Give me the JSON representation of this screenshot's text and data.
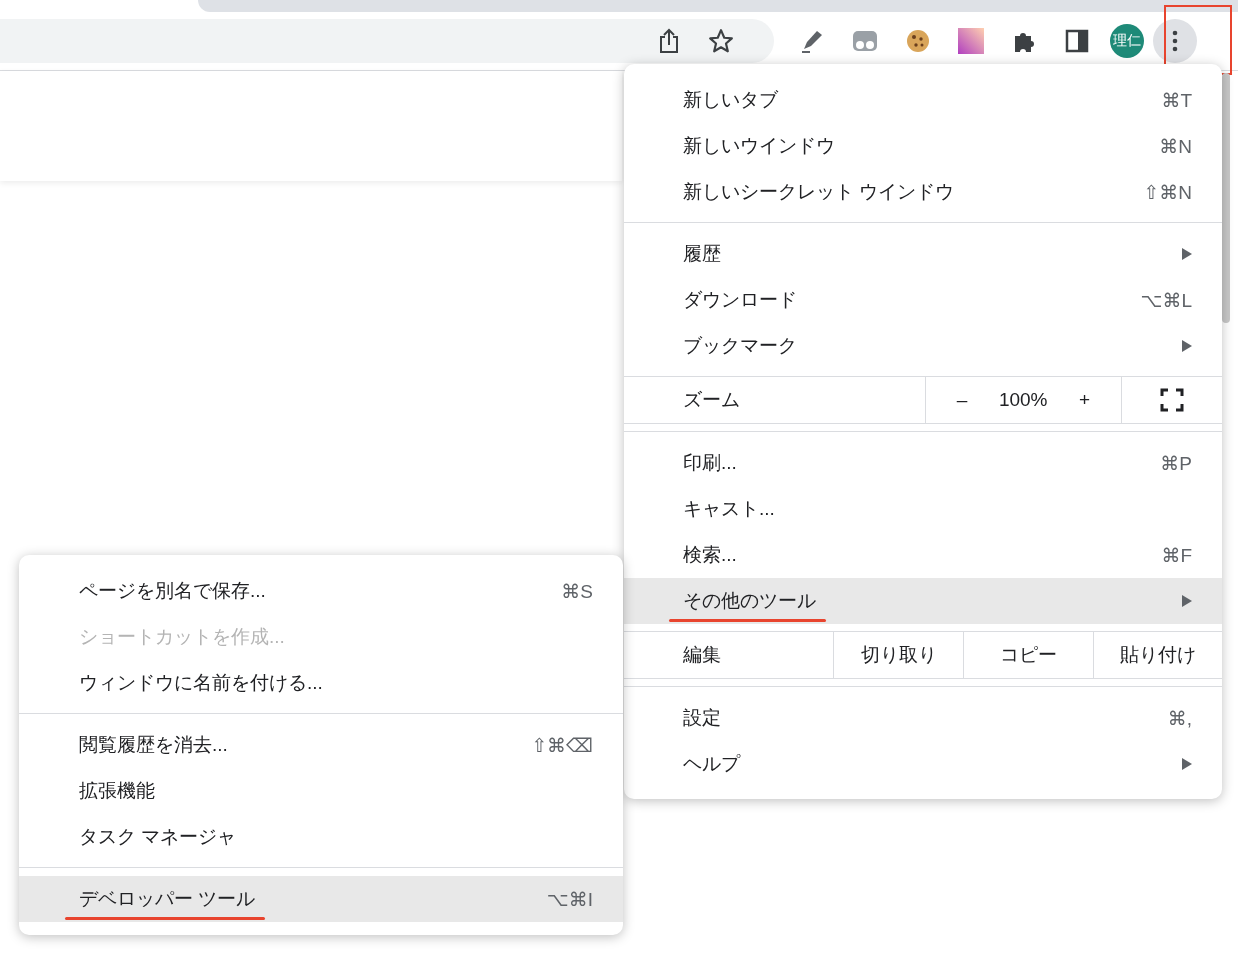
{
  "toolbar": {
    "avatar": {
      "label": "理仁"
    },
    "menu_button": {
      "highlighted": true
    }
  },
  "menu": {
    "sections": [
      [
        {
          "kind": "item",
          "label": "新しいタブ",
          "shortcut": "⌘T",
          "has_submenu": false,
          "selected": false,
          "disabled": false,
          "underlined": false
        },
        {
          "kind": "item",
          "label": "新しいウインドウ",
          "shortcut": "⌘N",
          "has_submenu": false,
          "selected": false,
          "disabled": false,
          "underlined": false
        },
        {
          "kind": "item",
          "label": "新しいシークレット ウインドウ",
          "shortcut": "⇧⌘N",
          "has_submenu": false,
          "selected": false,
          "disabled": false,
          "underlined": false
        }
      ],
      [
        {
          "kind": "item",
          "label": "履歴",
          "has_submenu": true,
          "selected": false,
          "disabled": false,
          "underlined": false
        },
        {
          "kind": "item",
          "label": "ダウンロード",
          "shortcut": "⌥⌘L",
          "has_submenu": false,
          "selected": false,
          "disabled": false,
          "underlined": false
        },
        {
          "kind": "item",
          "label": "ブックマーク",
          "has_submenu": true,
          "selected": false,
          "disabled": false,
          "underlined": false
        }
      ],
      [
        {
          "kind": "zoom",
          "label": "ズーム",
          "minus": "–",
          "value": "100%",
          "plus": "+"
        }
      ],
      [
        {
          "kind": "item",
          "label": "印刷...",
          "shortcut": "⌘P",
          "has_submenu": false,
          "selected": false,
          "disabled": false,
          "underlined": false
        },
        {
          "kind": "item",
          "label": "キャスト...",
          "has_submenu": false,
          "selected": false,
          "disabled": false,
          "underlined": false
        },
        {
          "kind": "item",
          "label": "検索...",
          "shortcut": "⌘F",
          "has_submenu": false,
          "selected": false,
          "disabled": false,
          "underlined": false
        },
        {
          "kind": "item",
          "label": "その他のツール",
          "has_submenu": true,
          "selected": true,
          "disabled": false,
          "underlined": true
        }
      ],
      [
        {
          "kind": "edit",
          "label": "編集",
          "actions": [
            "切り取り",
            "コピー",
            "貼り付け"
          ]
        }
      ],
      [
        {
          "kind": "item",
          "label": "設定",
          "shortcut": "⌘,",
          "has_submenu": false,
          "selected": false,
          "disabled": false,
          "underlined": false
        },
        {
          "kind": "item",
          "label": "ヘルプ",
          "has_submenu": true,
          "selected": false,
          "disabled": false,
          "underlined": false
        }
      ]
    ]
  },
  "submenu": {
    "sections": [
      [
        {
          "kind": "item",
          "label": "ページを別名で保存...",
          "shortcut": "⌘S",
          "has_submenu": false,
          "selected": false,
          "disabled": false,
          "underlined": false
        },
        {
          "kind": "item",
          "label": "ショートカットを作成...",
          "has_submenu": false,
          "selected": false,
          "disabled": true,
          "underlined": false
        },
        {
          "kind": "item",
          "label": "ウィンドウに名前を付ける...",
          "has_submenu": false,
          "selected": false,
          "disabled": false,
          "underlined": false
        }
      ],
      [
        {
          "kind": "item",
          "label": "閲覧履歴を消去...",
          "shortcut": "⇧⌘⌫",
          "has_submenu": false,
          "selected": false,
          "disabled": false,
          "underlined": false
        },
        {
          "kind": "item",
          "label": "拡張機能",
          "has_submenu": false,
          "selected": false,
          "disabled": false,
          "underlined": false
        },
        {
          "kind": "item",
          "label": "タスク マネージャ",
          "has_submenu": false,
          "selected": false,
          "disabled": false,
          "underlined": false
        }
      ],
      [
        {
          "kind": "item",
          "label": "デベロッパー ツール",
          "shortcut": "⌥⌘I",
          "has_submenu": false,
          "selected": true,
          "disabled": false,
          "underlined": true
        }
      ]
    ]
  }
}
